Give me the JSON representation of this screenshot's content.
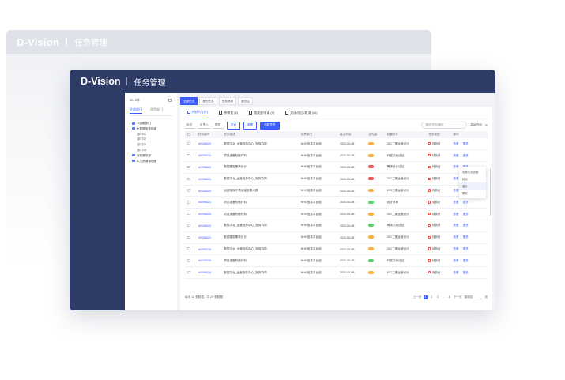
{
  "ghost": {
    "logo": "D-Vision",
    "title": "任务管理"
  },
  "app": {
    "logo": "D-Vision",
    "title": "任务管理"
  },
  "dept_panel": {
    "year": "2019年",
    "tabs": [
      "全部部门",
      "常用部门"
    ],
    "tree": [
      {
        "label": "IT运维部门",
        "level": 1
      },
      {
        "label": "大数据信息化部",
        "level": 1
      },
      {
        "label": "部门01",
        "level": 2
      },
      {
        "label": "部门02",
        "level": 2
      },
      {
        "label": "部门03",
        "level": 2
      },
      {
        "label": "部门04",
        "level": 2
      },
      {
        "label": "行政服务部",
        "level": 1
      },
      {
        "label": "人力资源管理部",
        "level": 1
      }
    ]
  },
  "view_tabs": [
    "全部任务",
    "我的任务",
    "任务消息",
    "我关注"
  ],
  "status_tabs": [
    "待执行 (27)",
    "待审批 (2)",
    "我发起申请 (9)",
    "关闭/驳回/取消 (46)"
  ],
  "filters": {
    "selects": [
      "状态",
      "负责人",
      "类型"
    ],
    "query": "查询",
    "reset": "重置",
    "new": "创建任务",
    "search_placeholder": "编号/任务编码",
    "advanced": "高级查询"
  },
  "table": {
    "headers": [
      "",
      "任务编号",
      "任务描述",
      "负责部门",
      "截止时间",
      "优先级",
      "前置条件",
      "任务类型",
      "操作"
    ],
    "rows": [
      {
        "no": "#0098624",
        "desc": "数据平台_运营指挥中心_指挥协同",
        "dept": "NHG信息平台组",
        "date": "2020-05-08",
        "prio": "orange",
        "cond": "IOC二期运营设计",
        "type": "待执行"
      },
      {
        "no": "#0098624",
        "desc": "项目准备阶段材料",
        "dept": "NHG信息平台组",
        "date": "2020-05-08",
        "prio": "orange",
        "cond": "开发方案论证",
        "type": "待执行"
      },
      {
        "no": "#0098624",
        "desc": "数据模型需求设计",
        "dept": "NHG信息平台组",
        "date": "2020-05-08",
        "prio": "red",
        "cond": "需求设计论证",
        "type": "待执行"
      },
      {
        "no": "#0098624",
        "desc": "数据平台_运营指挥中心_指挥协同",
        "dept": "NHG信息平台组",
        "date": "2020-05-08",
        "prio": "red",
        "cond": "IOC二期运营设计",
        "type": "待执行"
      },
      {
        "no": "#0098624",
        "desc": "运营指挥专项运营支撑大屏",
        "dept": "NHG信息平台组",
        "date": "2020-05-08",
        "prio": "orange",
        "cond": "IOC二期运营设计",
        "type": "待执行"
      },
      {
        "no": "#0098624",
        "desc": "项目准备阶段材料",
        "dept": "NHG信息平台组",
        "date": "2020-05-08",
        "prio": "green",
        "cond": "设计评审",
        "type": "待执行"
      },
      {
        "no": "#0098624",
        "desc": "项目准备阶段材料",
        "dept": "NHG信息平台组",
        "date": "2020-05-08",
        "prio": "orange",
        "cond": "IOC二期运营设计",
        "type": "待执行"
      },
      {
        "no": "#0098624",
        "desc": "数据平台_运营指挥中心_指挥协同",
        "dept": "NHG信息平台组",
        "date": "2020-05-08",
        "prio": "green",
        "cond": "需求方案论证",
        "type": "待执行"
      },
      {
        "no": "#0098624",
        "desc": "数据模型需求设计",
        "dept": "NHG信息平台组",
        "date": "2020-05-08",
        "prio": "orange",
        "cond": "IOC二期运营设计",
        "type": "待执行"
      },
      {
        "no": "#0098624",
        "desc": "数据平台_运营指挥中心_指挥协同",
        "dept": "NHG信息平台组",
        "date": "2020-05-08",
        "prio": "orange",
        "cond": "IOC二期运营设计",
        "type": "待执行"
      },
      {
        "no": "#0098624",
        "desc": "项目准备阶段材料",
        "dept": "NHG信息平台组",
        "date": "2020-05-08",
        "prio": "green",
        "cond": "开发方案论证",
        "type": "待执行"
      },
      {
        "no": "#0098624",
        "desc": "数据平台_运营指挥中心_指挥协同",
        "dept": "NHG信息平台组",
        "date": "2020-05-08",
        "prio": "orange",
        "cond": "IOC二期运营设计",
        "type": "待执行"
      }
    ],
    "op_view": "查看",
    "op_more": "更多"
  },
  "dropdown": [
    "查看任务进度",
    "转派",
    "催办",
    "删除"
  ],
  "pager": {
    "summary": "每页 12 条数据，共 24 条数据",
    "prev": "上一页",
    "pages": [
      "1",
      "2",
      "3",
      "...",
      "8"
    ],
    "next": "下一页",
    "jump": "跳转至",
    "unit": "页"
  },
  "colors": {
    "brand": "#2d3b66",
    "accent": "#3b5cff"
  }
}
